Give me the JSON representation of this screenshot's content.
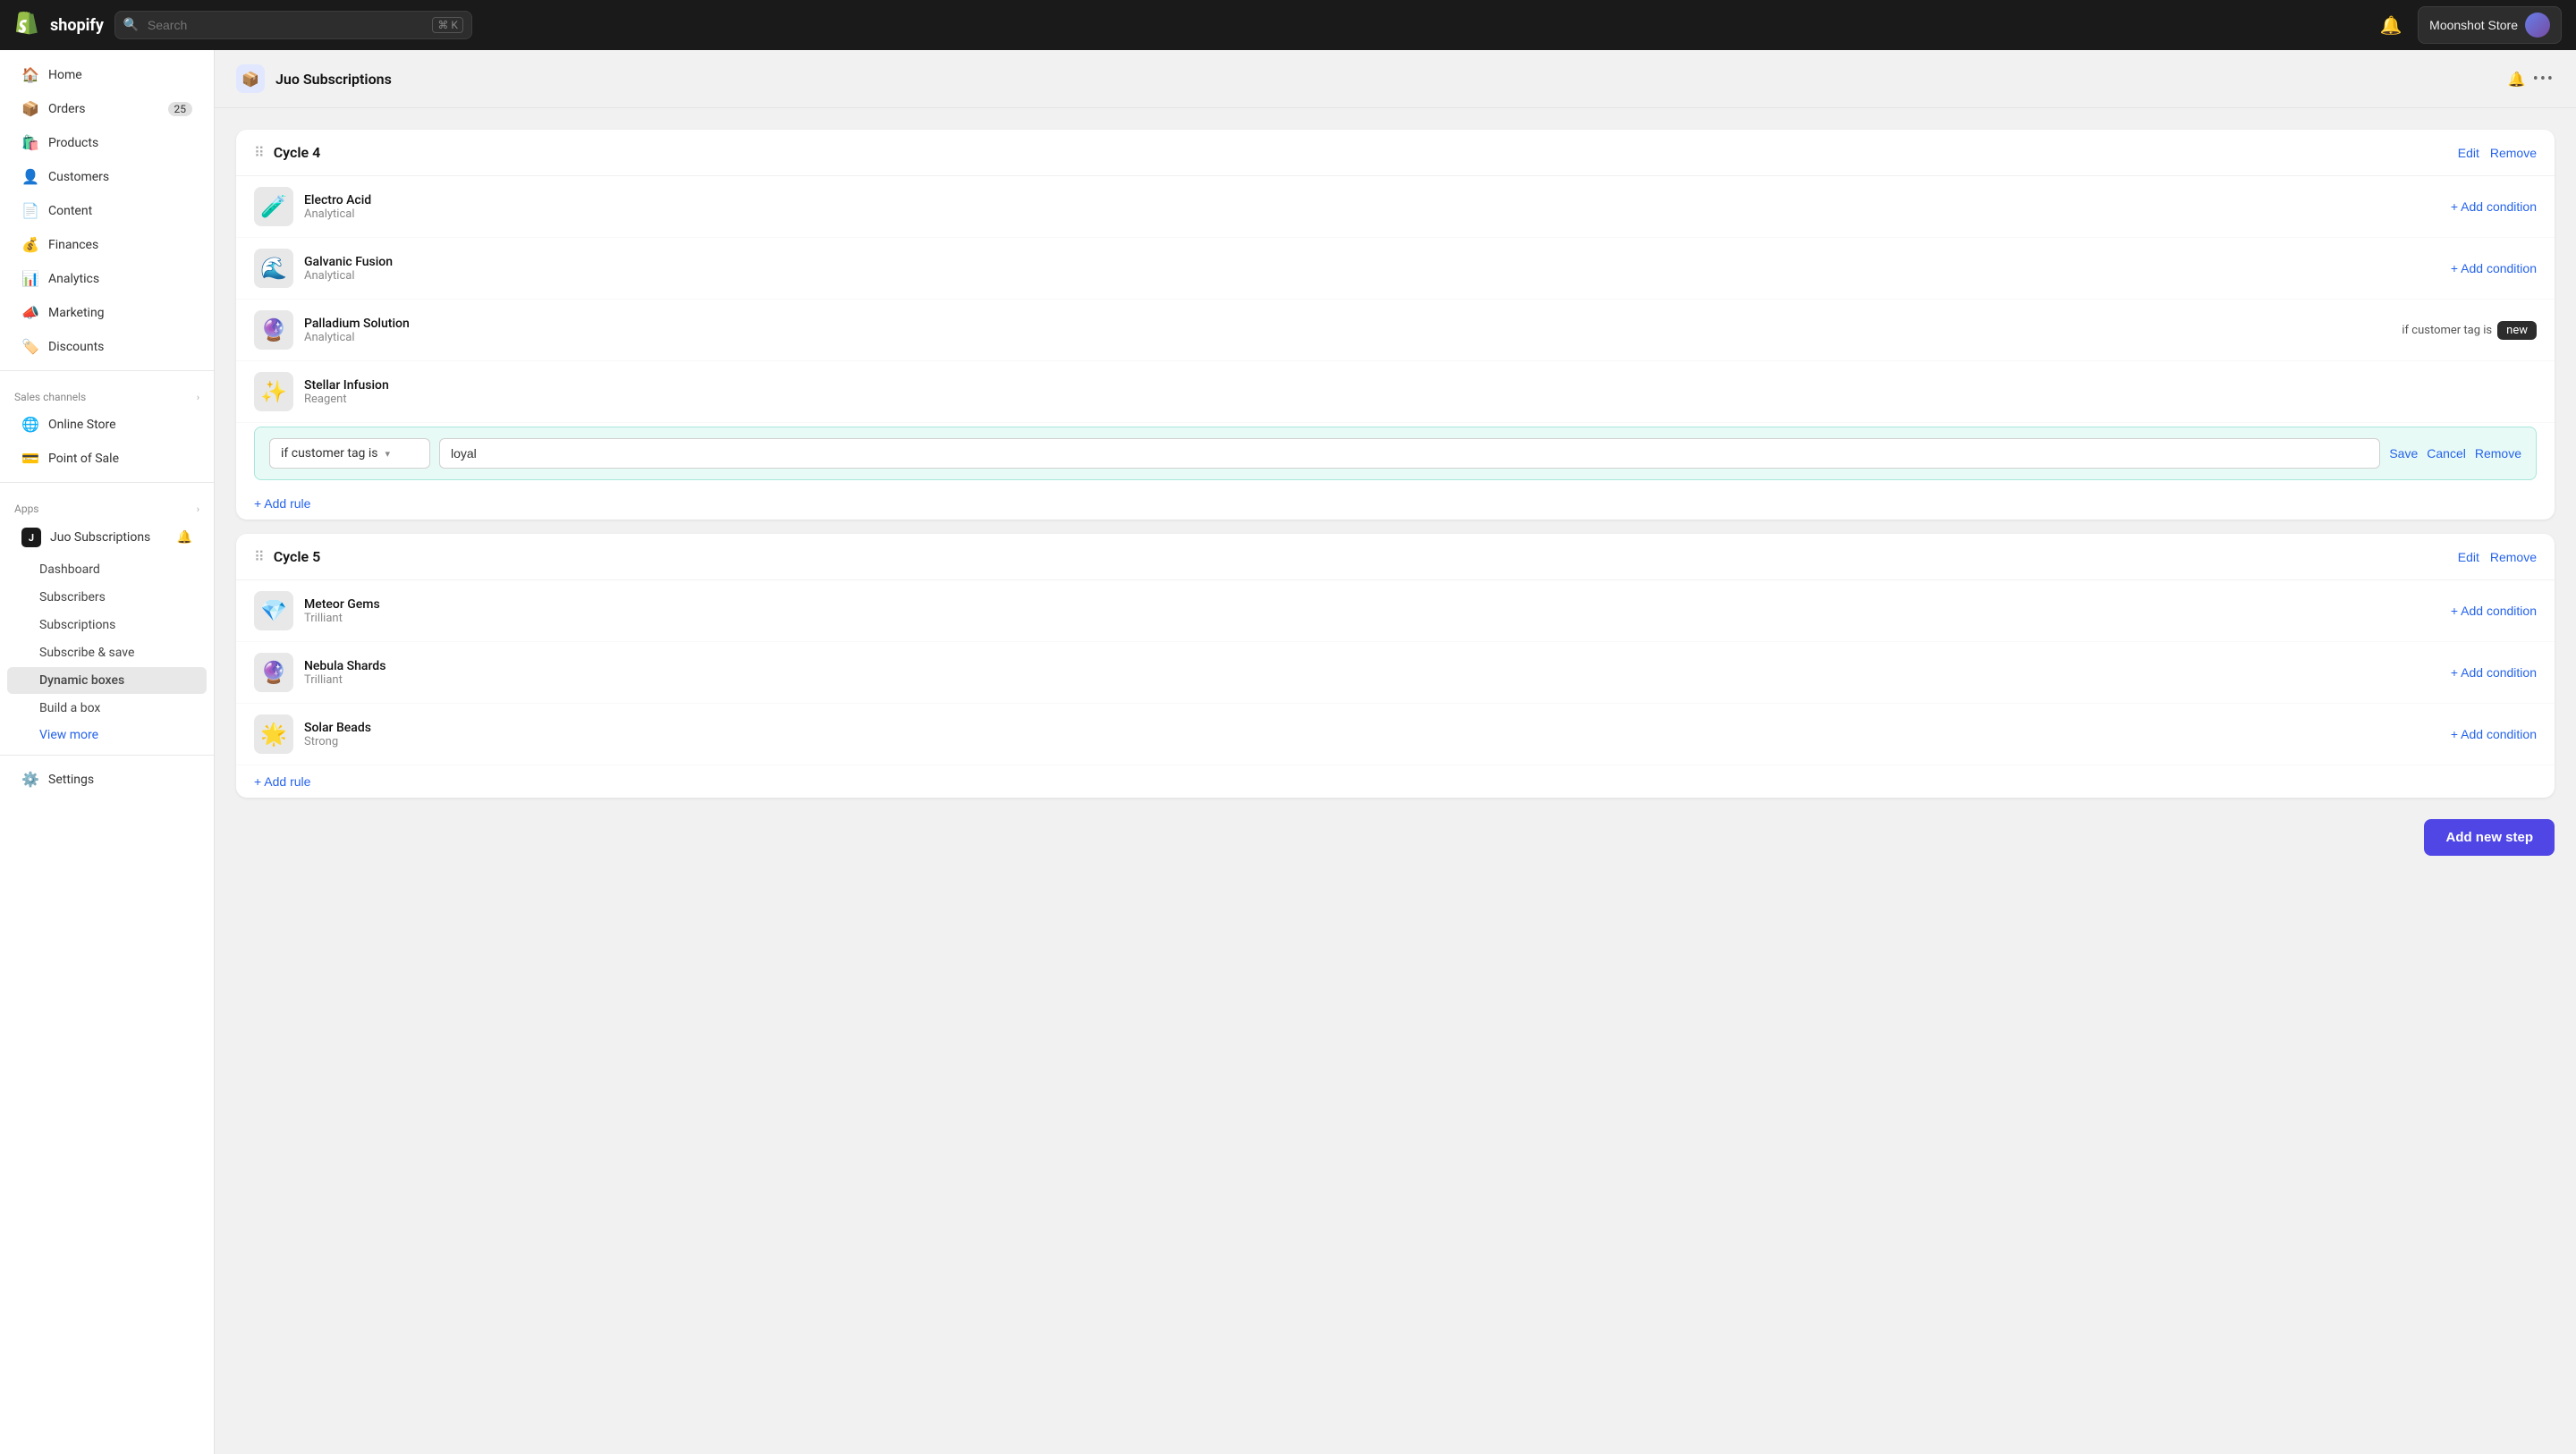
{
  "topnav": {
    "logo_text": "shopify",
    "search_placeholder": "Search",
    "search_shortcut": "⌘ K",
    "store_name": "Moonshot Store"
  },
  "sidebar": {
    "nav_items": [
      {
        "id": "home",
        "label": "Home",
        "icon": "🏠",
        "badge": null
      },
      {
        "id": "orders",
        "label": "Orders",
        "icon": "📦",
        "badge": "25"
      },
      {
        "id": "products",
        "label": "Products",
        "icon": "🛍️",
        "badge": null
      },
      {
        "id": "customers",
        "label": "Customers",
        "icon": "👤",
        "badge": null
      },
      {
        "id": "content",
        "label": "Content",
        "icon": "📄",
        "badge": null
      },
      {
        "id": "finances",
        "label": "Finances",
        "icon": "💰",
        "badge": null
      },
      {
        "id": "analytics",
        "label": "Analytics",
        "icon": "📊",
        "badge": null
      },
      {
        "id": "marketing",
        "label": "Marketing",
        "icon": "📣",
        "badge": null
      },
      {
        "id": "discounts",
        "label": "Discounts",
        "icon": "🏷️",
        "badge": null
      }
    ],
    "sales_channels_label": "Sales channels",
    "sales_channels": [
      {
        "id": "online-store",
        "label": "Online Store",
        "icon": "🌐"
      },
      {
        "id": "point-of-sale",
        "label": "Point of Sale",
        "icon": "💳"
      }
    ],
    "apps_label": "Apps",
    "app_name": "Juo Subscriptions",
    "app_subitems": [
      {
        "id": "dashboard",
        "label": "Dashboard"
      },
      {
        "id": "subscribers",
        "label": "Subscribers"
      },
      {
        "id": "subscriptions",
        "label": "Subscriptions"
      },
      {
        "id": "subscribe-save",
        "label": "Subscribe & save"
      },
      {
        "id": "dynamic-boxes",
        "label": "Dynamic boxes",
        "active": true
      },
      {
        "id": "build-a-box",
        "label": "Build a box"
      }
    ],
    "view_more_label": "View more",
    "settings_label": "Settings"
  },
  "page": {
    "title": "Juo Subscriptions",
    "cycle4": {
      "title": "Cycle 4",
      "edit_label": "Edit",
      "remove_label": "Remove",
      "products": [
        {
          "id": "p1",
          "name": "Electro Acid",
          "category": "Analytical",
          "emoji": "🧪"
        },
        {
          "id": "p2",
          "name": "Galvanic Fusion",
          "category": "Analytical",
          "emoji": "🌊"
        },
        {
          "id": "p3",
          "name": "Palladium Solution",
          "category": "Analytical",
          "emoji": "🔮",
          "condition_label": "if customer tag is",
          "condition_value": "new"
        },
        {
          "id": "p4",
          "name": "Stellar Infusion",
          "category": "Reagent",
          "emoji": "✨",
          "has_edit": true
        }
      ],
      "condition_edit": {
        "select_value": "if customer tag is",
        "input_value": "loyal",
        "save_label": "Save",
        "cancel_label": "Cancel",
        "remove_label": "Remove"
      },
      "add_condition_label": "+ Add condition",
      "add_rule_label": "+ Add rule"
    },
    "cycle5": {
      "title": "Cycle 5",
      "edit_label": "Edit",
      "remove_label": "Remove",
      "products": [
        {
          "id": "p5",
          "name": "Meteor Gems",
          "category": "Trilliant",
          "emoji": "💎"
        },
        {
          "id": "p6",
          "name": "Nebula Shards",
          "category": "Trilliant",
          "emoji": "🔮"
        },
        {
          "id": "p7",
          "name": "Solar Beads",
          "category": "Strong",
          "emoji": "🌟"
        }
      ],
      "add_condition_label": "+ Add condition",
      "add_rule_label": "+ Add rule"
    },
    "add_new_step_label": "Add new step"
  },
  "colors": {
    "accent": "#2563eb",
    "primary_btn": "#4f46e5",
    "condition_bg": "#e8faf6",
    "condition_border": "#a8e6d9"
  }
}
